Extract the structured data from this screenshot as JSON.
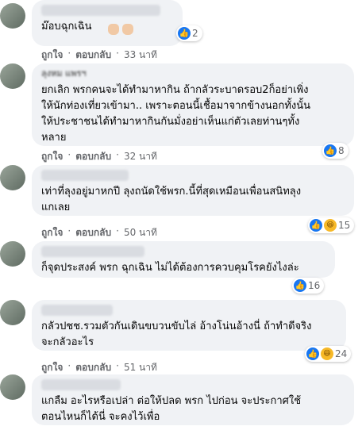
{
  "actions": {
    "like_label": "ถูกใจ",
    "reply_label": "ตอบกลับ",
    "separator": "·"
  },
  "comments": [
    {
      "text": "ม๊อบฉุกเฉิน",
      "reactions": {
        "count": "2"
      },
      "time": "33 นาที"
    },
    {
      "author": "ลุงหม แพรฯ",
      "text": "ยกเลิก พรกคนจะได้ทำมาหากิน ถ้ากลัวระบาดรอบ2ก็อย่าเพิ่ง\nให้นักท่องเที่ยวเข้ามา.. เพราะตอนนี้เชื้อมาจากข้างนอกทั้งนั้น\nให้ประชาชนได้ทำมาหากินกันมั่งอย่าเห็นแก่ตัวเลยท่านๆทั้ง\nหลาย",
      "reactions": {
        "count": "8"
      },
      "time": "32 นาที"
    },
    {
      "text": "เท่าที่ลุงอยู่มาหกปี ลุงถนัดใช้พรก.นี้ที่สุดเหมือนเพื่อนสนิทลุง\nแกเลย",
      "reactions": {
        "count": "15"
      },
      "time": "50 นาที"
    },
    {
      "text": "ก็จุดประสงค์ พรก ฉุกเฉิน ไม่ได้ต้องการควบคุมโรคยังไงล่ะ",
      "reactions": {
        "count": "16"
      },
      "time": ""
    },
    {
      "text": "กลัวปชช.รวมตัวกันเดินขบวนขับไล่ อ้างโน่นอ้างนี่ ถ้าทำดีจริง\nจะกลัวอะไร",
      "reactions": {
        "count": "24"
      },
      "time": "51 นาที"
    },
    {
      "text": "แกลืม อะไรหรือเปล่า ต่อให้ปลด พรก ไปก่อน จะประกาศใช้\nตอนไหนก็ได้นี่ จะคงไว้เพื่อ",
      "reactions": {
        "count": ""
      },
      "time": ""
    }
  ],
  "colors": {
    "bubble": "#f0f2f5",
    "like_blue": "#1877f2",
    "meta_gray": "#65676b"
  }
}
